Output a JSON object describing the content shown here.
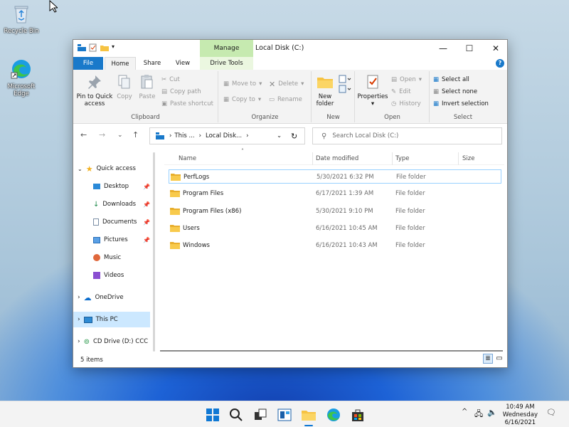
{
  "desktop": {
    "icons": [
      {
        "label": "Recycle Bin"
      },
      {
        "label": "Microsoft Edge"
      }
    ]
  },
  "window": {
    "title": "Local Disk (C:)",
    "manage_label": "Manage",
    "min_icon": "minimize-icon",
    "max_icon": "maximize-icon",
    "close_icon": "close-icon"
  },
  "tabs": {
    "file": "File",
    "home": "Home",
    "share": "Share",
    "view": "View",
    "drive_tools": "Drive Tools"
  },
  "ribbon": {
    "clipboard": {
      "label": "Clipboard",
      "pin": "Pin to Quick access",
      "copy": "Copy",
      "paste": "Paste",
      "cut": "Cut",
      "copy_path": "Copy path",
      "paste_shortcut": "Paste shortcut"
    },
    "organize": {
      "label": "Organize",
      "move_to": "Move to",
      "copy_to": "Copy to",
      "delete": "Delete",
      "rename": "Rename"
    },
    "new": {
      "label": "New",
      "new_folder": "New folder"
    },
    "open": {
      "label": "Open",
      "properties": "Properties",
      "open": "Open",
      "edit": "Edit",
      "history": "History"
    },
    "select": {
      "label": "Select",
      "select_all": "Select all",
      "select_none": "Select none",
      "invert": "Invert selection"
    }
  },
  "address": {
    "seg1": "This ...",
    "seg2": "Local Disk...",
    "search_placeholder": "Search Local Disk (C:)"
  },
  "nav": {
    "quick_access": "Quick access",
    "items": [
      {
        "label": "Desktop"
      },
      {
        "label": "Downloads"
      },
      {
        "label": "Documents"
      },
      {
        "label": "Pictures"
      },
      {
        "label": "Music"
      },
      {
        "label": "Videos"
      }
    ],
    "onedrive": "OneDrive",
    "this_pc": "This PC",
    "cd_drive": "CD Drive (D:) CCC"
  },
  "columns": {
    "name": "Name",
    "date": "Date modified",
    "type": "Type",
    "size": "Size"
  },
  "files": [
    {
      "name": "PerfLogs",
      "date": "5/30/2021 6:32 PM",
      "type": "File folder"
    },
    {
      "name": "Program Files",
      "date": "6/17/2021 1:39 AM",
      "type": "File folder"
    },
    {
      "name": "Program Files (x86)",
      "date": "5/30/2021 9:10 PM",
      "type": "File folder"
    },
    {
      "name": "Users",
      "date": "6/16/2021 10:45 AM",
      "type": "File folder"
    },
    {
      "name": "Windows",
      "date": "6/16/2021 10:43 AM",
      "type": "File folder"
    }
  ],
  "status": {
    "count": "5 items"
  },
  "clock": {
    "time": "10:49 AM",
    "day": "Wednesday",
    "date": "6/16/2021"
  },
  "colors": {
    "accent": "#1979ca",
    "folder": "#f6c343",
    "manage": "#c6eab0"
  }
}
